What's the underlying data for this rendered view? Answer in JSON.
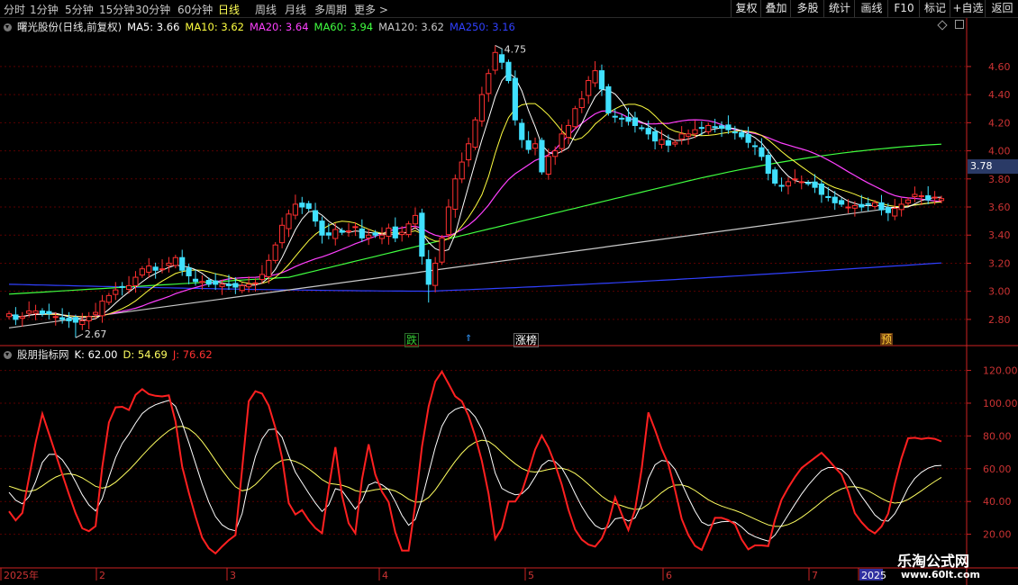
{
  "toolbar": {
    "periods": [
      "分时",
      "1分钟",
      "5分钟",
      "15分钟",
      "30分钟",
      "60分钟",
      "日线",
      "周线",
      "月线",
      "多周期",
      "更多 >"
    ],
    "active_period": "日线",
    "right_buttons": [
      "复权",
      "叠加",
      "多股",
      "统计",
      "画线",
      "F10",
      "标记",
      "+自选",
      "返回"
    ]
  },
  "main_legend": {
    "stock": "曙光股份(日线,前复权)",
    "ma5": "MA5: 3.66",
    "ma10": "MA10: 3.62",
    "ma20": "MA20: 3.64",
    "ma60": "MA60: 3.94",
    "ma120": "MA120: 3.62",
    "ma250": "MA250: 3.16"
  },
  "sub_legend": {
    "name": "股朋指标网",
    "k": "K: 62.00",
    "d": "D: 54.69",
    "j": "J: 76.62"
  },
  "price_tag": "3.78",
  "events": [
    {
      "label": "跌",
      "color": "#33cc33"
    },
    {
      "label": "涨榜",
      "color": "#ffffff"
    },
    {
      "label": "预",
      "color": "#ffcc33"
    }
  ],
  "watermark": {
    "title": "乐淘公式网",
    "url": "www.60lt.com"
  },
  "colors": {
    "up": "#ff3030",
    "down": "#40e0ff",
    "ma5": "#ffffff",
    "ma10": "#ffff40",
    "ma20": "#ff40ff",
    "ma60": "#40ff40",
    "ma120": "#c8c8c8",
    "ma250": "#3040ff",
    "grid": "#5a0000",
    "axis": "#cc2222",
    "k": "#ffffff",
    "d": "#ffff60",
    "j": "#ff2020"
  },
  "chart_data": [
    {
      "type": "candlestick",
      "title": "曙光股份(日线,前复权)",
      "y_ticks": [
        2.8,
        3.0,
        3.2,
        3.4,
        3.6,
        3.8,
        4.0,
        4.2,
        4.4,
        4.6
      ],
      "ylim": [
        2.62,
        4.83
      ],
      "annotations": [
        {
          "label": "4.75",
          "value": 4.75
        },
        {
          "label": "2.67",
          "value": 2.67
        }
      ],
      "close": [
        2.84,
        2.8,
        2.82,
        2.86,
        2.86,
        2.84,
        2.84,
        2.82,
        2.8,
        2.79,
        2.78,
        2.79,
        2.82,
        2.85,
        2.93,
        2.97,
        3.01,
        3.03,
        3.04,
        3.1,
        3.16,
        3.18,
        3.15,
        3.16,
        3.2,
        3.24,
        3.15,
        3.11,
        3.07,
        3.07,
        3.05,
        3.05,
        3.05,
        3.04,
        3.03,
        3.04,
        3.05,
        3.06,
        3.12,
        3.22,
        3.33,
        3.47,
        3.55,
        3.62,
        3.6,
        3.59,
        3.5,
        3.4,
        3.4,
        3.44,
        3.42,
        3.43,
        3.46,
        3.38,
        3.4,
        3.4,
        3.4,
        3.45,
        3.38,
        3.42,
        3.48,
        3.54,
        3.25,
        3.05,
        3.2,
        3.38,
        3.6,
        3.8,
        3.92,
        4.05,
        4.22,
        4.4,
        4.55,
        4.7,
        4.63,
        4.5,
        4.22,
        4.08,
        4.01,
        4.05,
        3.85,
        3.96,
        4.0,
        4.12,
        4.18,
        4.3,
        4.37,
        4.5,
        4.57,
        4.44,
        4.27,
        4.24,
        4.23,
        4.21,
        4.18,
        4.16,
        4.12,
        4.07,
        4.08,
        4.04,
        4.06,
        4.12,
        4.12,
        4.15,
        4.16,
        4.18,
        4.17,
        4.16,
        4.15,
        4.13,
        4.1,
        4.06,
        4.03,
        3.96,
        3.84,
        3.77,
        3.75,
        3.78,
        3.8,
        3.78,
        3.77,
        3.74,
        3.69,
        3.67,
        3.63,
        3.62,
        3.6,
        3.61,
        3.6,
        3.62,
        3.63,
        3.58,
        3.56,
        3.59,
        3.62,
        3.65,
        3.69,
        3.68,
        3.65,
        3.67,
        3.66
      ],
      "series": [
        {
          "name": "MA5",
          "values": [
            3.66
          ]
        },
        {
          "name": "MA10",
          "values": [
            3.62
          ]
        },
        {
          "name": "MA20",
          "values": [
            3.64
          ]
        },
        {
          "name": "MA60",
          "values": [
            3.94
          ]
        },
        {
          "name": "MA120",
          "values": [
            3.62
          ]
        },
        {
          "name": "MA250",
          "values": [
            3.16
          ]
        }
      ],
      "x_ticks": [
        "2025年",
        "2",
        "3",
        "4",
        "5",
        "6",
        "7",
        "2025"
      ]
    },
    {
      "type": "line",
      "title": "股朋指标网",
      "y_ticks": [
        20.0,
        40.0,
        60.0,
        80.0,
        100.0,
        120.0
      ],
      "ylim": [
        0,
        128
      ],
      "series": [
        {
          "name": "K",
          "last": 62.0
        },
        {
          "name": "D",
          "last": 54.69
        },
        {
          "name": "J",
          "last": 76.62
        }
      ]
    }
  ]
}
